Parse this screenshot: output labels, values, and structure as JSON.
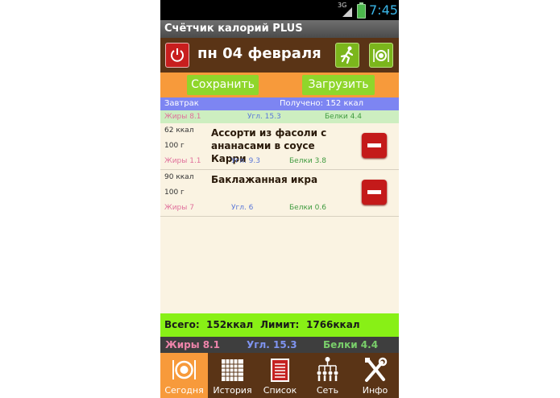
{
  "status_bar": {
    "network": "3G",
    "time": "7:45"
  },
  "app": {
    "title": "Счётчик калорий PLUS"
  },
  "header": {
    "date": "пн 04 февраля"
  },
  "actions": {
    "save_label": "Сохранить",
    "load_label": "Загрузить"
  },
  "meal": {
    "name": "Завтрак",
    "received": "Получено: 152 ккал",
    "fat": "Жиры 8.1",
    "carbs": "Угл. 15.3",
    "protein": "Белки 4.4"
  },
  "foods": [
    {
      "kcal": "62 ккал",
      "grams": "100 г",
      "name": "Ассорти из фасоли с ананасами в соусе Карри",
      "fat": "Жиры 1.1",
      "carbs": "Угл. 9.3",
      "protein": "Белки 3.8"
    },
    {
      "kcal": "90 ккал",
      "grams": "100 г",
      "name": "Баклажанная икра",
      "fat": "Жиры 7",
      "carbs": "Угл. 6",
      "protein": "Белки 0.6"
    }
  ],
  "totals": {
    "total_label": "Всего:",
    "total_value": "152ккал",
    "limit_label": "Лимит:",
    "limit_value": "1766ккал"
  },
  "macro_totals": {
    "fat": "Жиры 8.1",
    "carbs": "Угл. 15.3",
    "protein": "Белки 4.4"
  },
  "nav": [
    {
      "label": "Сегодня",
      "icon": "plate-icon",
      "active": true
    },
    {
      "label": "История",
      "icon": "calendar-icon",
      "active": false
    },
    {
      "label": "Список",
      "icon": "list-icon",
      "active": false
    },
    {
      "label": "Сеть",
      "icon": "network-icon",
      "active": false
    },
    {
      "label": "Инфо",
      "icon": "tools-icon",
      "active": false
    }
  ],
  "colors": {
    "header_brown": "#5a3416",
    "accent_orange": "#f79a3b",
    "button_green": "#8fd62b",
    "meal_blue": "#7d85f2",
    "totals_green": "#88f016",
    "remove_red": "#c41a1a"
  }
}
